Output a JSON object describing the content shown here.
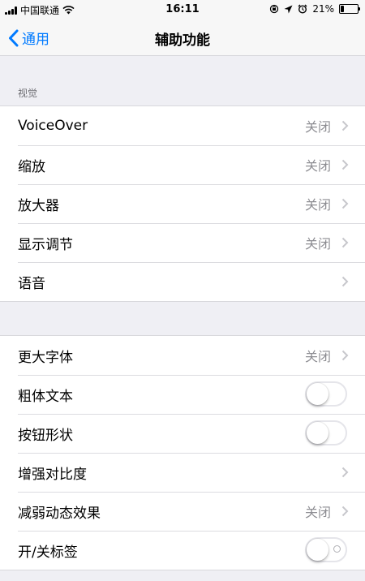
{
  "status_bar": {
    "carrier": "中国联通",
    "time": "16:11",
    "battery_percent_text": "21%",
    "battery_level": 0.21,
    "icons": [
      "signal-icon",
      "wifi-icon",
      "orientation-lock-icon",
      "location-icon",
      "alarm-icon",
      "battery-icon"
    ]
  },
  "nav": {
    "back_label": "通用",
    "title": "辅助功能"
  },
  "sections": {
    "vision_header": "视觉"
  },
  "vision_rows": [
    {
      "label": "VoiceOver",
      "value": "关闭"
    },
    {
      "label": "缩放",
      "value": "关闭"
    },
    {
      "label": "放大器",
      "value": "关闭"
    },
    {
      "label": "显示调节",
      "value": "关闭"
    },
    {
      "label": "语音",
      "value": ""
    }
  ],
  "display_rows": [
    {
      "label": "更大字体",
      "value": "关闭",
      "type": "disclosure"
    },
    {
      "label": "粗体文本",
      "type": "toggle",
      "on": false
    },
    {
      "label": "按钮形状",
      "type": "toggle",
      "on": false
    },
    {
      "label": "增强对比度",
      "value": "",
      "type": "disclosure"
    },
    {
      "label": "减弱动态效果",
      "value": "关闭",
      "type": "disclosure"
    },
    {
      "label": "开/关标签",
      "type": "toggle",
      "on": false,
      "with_off_label": true
    }
  ],
  "colors": {
    "accent": "#007aff",
    "background": "#efeff4",
    "secondary_text": "#8e8e93"
  }
}
